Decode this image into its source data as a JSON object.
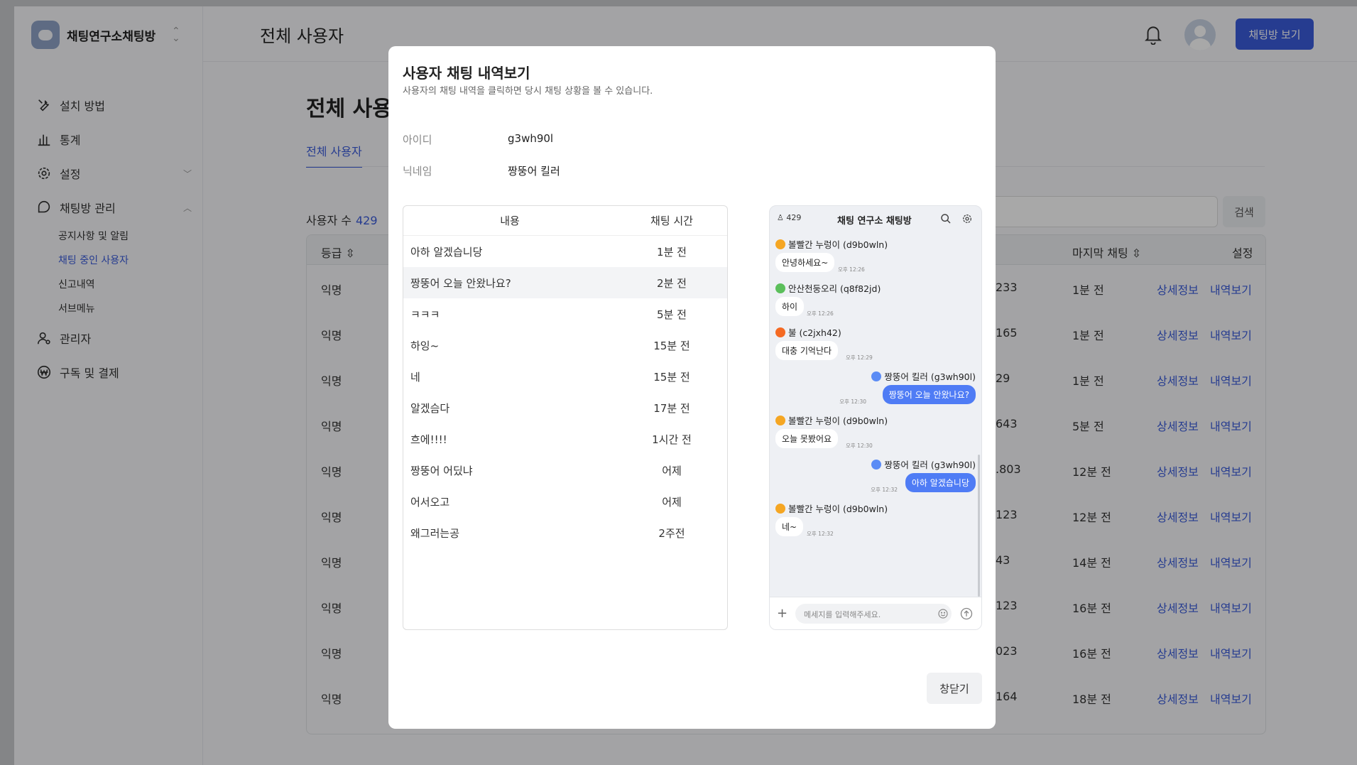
{
  "app": {
    "brand": "채팅연구소채팅방",
    "header_title": "전체 사용자",
    "view_button": "채팅방 보기"
  },
  "sidebar": {
    "items": [
      {
        "label": "설치 방법",
        "icon": "wrench-icon"
      },
      {
        "label": "통계",
        "icon": "bar-chart-icon"
      },
      {
        "label": "설정",
        "icon": "gear-icon"
      },
      {
        "label": "채팅방 관리",
        "icon": "chat-icon"
      }
    ],
    "sub_items": [
      "공지사항 및 알림",
      "채팅 중인 사용자",
      "신고내역",
      "서브메뉴"
    ],
    "items2": [
      {
        "label": "관리자",
        "icon": "admin-icon"
      },
      {
        "label": "구독 및 결제",
        "icon": "won-icon"
      }
    ]
  },
  "main": {
    "title": "전체 사용자",
    "tab": "전체 사용자",
    "count_label": "사용자 수",
    "count": "429",
    "search_button": "검색",
    "columns": {
      "grade": "등급",
      "last_chat": "마지막 채팅",
      "settings": "설정"
    },
    "rows": [
      {
        "grade": "익명",
        "partial": "233",
        "last": "1분 전"
      },
      {
        "grade": "익명",
        "partial": "165",
        "last": "1분 전"
      },
      {
        "grade": "익명",
        "partial": "29",
        "last": "1분 전"
      },
      {
        "grade": "익명",
        "partial": "643",
        "last": "5분 전"
      },
      {
        "grade": "익명",
        "partial": ".803",
        "last": "12분 전"
      },
      {
        "grade": "익명",
        "partial": "123",
        "last": "12분 전"
      },
      {
        "grade": "익명",
        "partial": "43",
        "last": "14분 전"
      },
      {
        "grade": "익명",
        "partial": "123",
        "last": "16분 전"
      },
      {
        "grade": "익명",
        "partial": "023",
        "last": "16분 전"
      },
      {
        "grade": "익명",
        "partial": "164",
        "last": "18분 전"
      }
    ],
    "detail_link": "상세정보",
    "history_link": "내역보기"
  },
  "modal": {
    "title": "사용자 채팅 내역보기",
    "subtitle": "사용자의 채팅 내역을 클릭하면 당시 채팅 상황을 볼 수 있습니다.",
    "id_label": "아이디",
    "id_value": "g3wh90l",
    "nick_label": "닉네임",
    "nick_value": "짱뚱어 킬러",
    "list_headers": {
      "content": "내용",
      "time": "채팅 시간"
    },
    "list_rows": [
      {
        "content": "아하 알겠습니당",
        "time": "1분 전"
      },
      {
        "content": "짱뚱어 오늘 안왔나요?",
        "time": "2분 전"
      },
      {
        "content": "ㅋㅋㅋ",
        "time": "5분 전"
      },
      {
        "content": "하잉~",
        "time": "15분 전"
      },
      {
        "content": "네",
        "time": "15분 전"
      },
      {
        "content": "알겠슴다",
        "time": "17분 전"
      },
      {
        "content": "흐에!!!!",
        "time": "1시간 전"
      },
      {
        "content": "짱뚱어 어딨냐",
        "time": "어제"
      },
      {
        "content": "어서오고",
        "time": "어제"
      },
      {
        "content": "왜그러는공",
        "time": "2주전"
      }
    ],
    "close_button": "창닫기"
  },
  "phone": {
    "count": "429",
    "title": "채팅 연구소 채팅방",
    "input_placeholder": "메세지를 입력해주세요.",
    "messages": [
      {
        "name": "볼빨간 누렁이 (d9b0wln)",
        "text": "안녕하세요~",
        "time": "오후 12:26",
        "me": false
      },
      {
        "name": "안산천둥오리 (q8f82jd)",
        "text": "하이",
        "time": "오후 12:26",
        "me": false
      },
      {
        "name": "불 (c2jxh42)",
        "text": "대충 기억난다",
        "time": "오후 12:29",
        "me": false
      },
      {
        "name": "짱뚱어 킬러 (g3wh90l)",
        "text": "짱뚱어 오늘 안왔나요?",
        "time": "오후 12:30",
        "me": true
      },
      {
        "name": "볼빨간 누렁이 (d9b0wln)",
        "text": "오늘 못봤어요",
        "time": "오후 12:30",
        "me": false
      },
      {
        "name": "짱뚱어 킬러 (g3wh90l)",
        "text": "아하 알겠습니당",
        "time": "오후 12:32",
        "me": true
      },
      {
        "name": "볼빨간 누렁이 (d9b0wln)",
        "text": "네~",
        "time": "오후 12:32",
        "me": false
      }
    ]
  },
  "colors": {
    "accent": "#3b5bdb",
    "my_bubble": "#4f7cf5"
  }
}
